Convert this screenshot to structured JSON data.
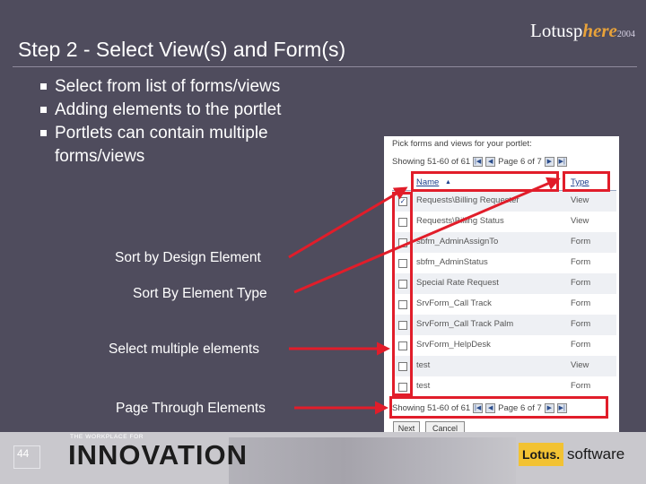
{
  "slide": {
    "title": "Step 2 - Select View(s) and Form(s)",
    "logo": {
      "brand_prefix": "Lotusp",
      "brand_highlight": "here",
      "year": "2004"
    },
    "bullets": [
      "Select from list of forms/views",
      "Adding elements to the portlet",
      "Portlets can contain multiple forms/views"
    ],
    "callouts": {
      "sort_design": "Sort by Design Element",
      "sort_type": "Sort By Element Type",
      "select_multiple": "Select multiple elements",
      "page_through": "Page Through Elements"
    },
    "page_number": "44",
    "footer": {
      "tagline": "THE WORKPLACE FOR",
      "innovation": "INNOVATION",
      "lotus": "Lotus.",
      "software": "software"
    },
    "highlight_color": "#e11d2a"
  },
  "portlet": {
    "pick_label": "Pick forms and views for your portlet:",
    "showing": "Showing 51-60 of 61",
    "page_indicator": "Page 6 of 7",
    "nav_icons": [
      "first-page-icon",
      "prev-page-icon",
      "next-page-icon",
      "last-page-icon"
    ],
    "columns": {
      "name": "Name",
      "type": "Type"
    },
    "rows": [
      {
        "name": "Requests\\Billing Requester",
        "type": "View",
        "checked": true
      },
      {
        "name": "Requests\\Billing Status",
        "type": "View",
        "checked": false
      },
      {
        "name": "sbfm_AdminAssignTo",
        "type": "Form",
        "checked": false
      },
      {
        "name": "sbfm_AdminStatus",
        "type": "Form",
        "checked": false
      },
      {
        "name": "Special Rate Request",
        "type": "Form",
        "checked": false
      },
      {
        "name": "SrvForm_Call Track",
        "type": "Form",
        "checked": false
      },
      {
        "name": "SrvForm_Call Track Palm",
        "type": "Form",
        "checked": false
      },
      {
        "name": "SrvForm_HelpDesk",
        "type": "Form",
        "checked": false
      },
      {
        "name": "test",
        "type": "View",
        "checked": false
      },
      {
        "name": "test",
        "type": "Form",
        "checked": false
      }
    ],
    "buttons": {
      "next": "Next",
      "cancel": "Cancel"
    }
  }
}
